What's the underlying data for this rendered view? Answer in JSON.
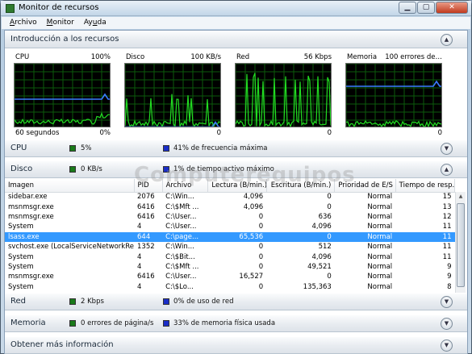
{
  "window": {
    "title": "Monitor de recursos"
  },
  "menu": [
    "Archivo",
    "Monitor",
    "Ayuda"
  ],
  "menu_underline": [
    "A",
    "M",
    "u"
  ],
  "overview": {
    "title": "Introducción a los recursos",
    "graphs": [
      {
        "name": "CPU",
        "max": "100%",
        "span": "60 segundos",
        "min": "0%",
        "line_level": 0.45
      },
      {
        "name": "Disco",
        "max": "100 KB/s",
        "span": "",
        "min": "0",
        "line_level": 0.02
      },
      {
        "name": "Red",
        "max": "56 Kbps",
        "span": "",
        "min": "0",
        "line_level": 0.0
      },
      {
        "name": "Memoria",
        "max": "100 errores de…",
        "span": "",
        "min": "0",
        "line_level": 0.65
      }
    ]
  },
  "cpu": {
    "title": "CPU",
    "value": "5%",
    "detail": "41% de frecuencia máxima"
  },
  "disk": {
    "title": "Disco",
    "value": "0 KB/s",
    "detail": "1% de tiempo activo máximo",
    "columns": [
      "Imagen",
      "PID",
      "Archivo",
      "Lectura (B/min.)",
      "Escritura (B/min.)",
      "Prioridad de E/S",
      "Tiempo de resp..."
    ],
    "rows": [
      [
        "sidebar.exe",
        "2076",
        "C:\\Win...",
        "4,096",
        "0",
        "Normal",
        "15"
      ],
      [
        "msnmsgr.exe",
        "6416",
        "C:\\$Mft ...",
        "4,096",
        "0",
        "Normal",
        "13"
      ],
      [
        "msnmsgr.exe",
        "6416",
        "C:\\User...",
        "0",
        "636",
        "Normal",
        "12"
      ],
      [
        "System",
        "4",
        "C:\\User...",
        "0",
        "4,096",
        "Normal",
        "11"
      ],
      [
        "lsass.exe",
        "644",
        "C:\\page...",
        "65,536",
        "0",
        "Normal",
        "11"
      ],
      [
        "svchost.exe (LocalServiceNetworkRest...",
        "1352",
        "C:\\Win...",
        "0",
        "512",
        "Normal",
        "11"
      ],
      [
        "System",
        "4",
        "C:\\$Bit...",
        "0",
        "4,096",
        "Normal",
        "11"
      ],
      [
        "System",
        "4",
        "C:\\$Mft ...",
        "0",
        "49,521",
        "Normal",
        "9"
      ],
      [
        "msnmsgr.exe",
        "6416",
        "C:\\User...",
        "16,527",
        "0",
        "Normal",
        "9"
      ],
      [
        "System",
        "4",
        "C:\\$Lo...",
        "0",
        "135,363",
        "Normal",
        "8"
      ]
    ],
    "selected_row": 4
  },
  "network": {
    "title": "Red",
    "value": "2 Kbps",
    "detail": "0% de uso de red"
  },
  "memory": {
    "title": "Memoria",
    "value": "0 errores de página/s",
    "detail": "33% de memoria física usada"
  },
  "more": {
    "title": "Obtener más información"
  },
  "watermark": "Computerequipos",
  "colors": {
    "green": "#1a7a1a",
    "blue": "#1a2ec8",
    "graph_green": "#22dd22",
    "graph_blue": "#3a7bff",
    "selection": "#3399ff"
  }
}
